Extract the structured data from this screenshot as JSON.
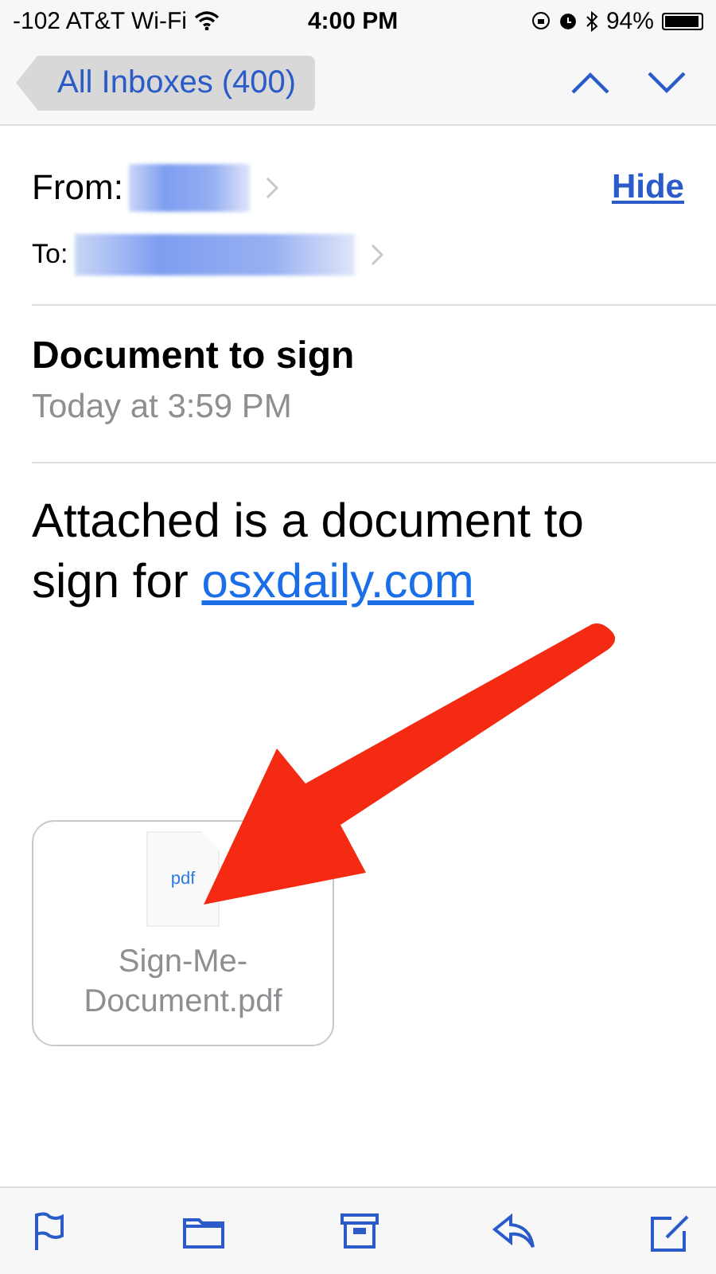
{
  "status_bar": {
    "carrier": "-102 AT&T Wi-Fi",
    "time": "4:00 PM",
    "battery": "94%"
  },
  "nav": {
    "back": "All Inboxes (400)"
  },
  "header": {
    "from_label": "From:",
    "to_label": "To:",
    "hide": "Hide"
  },
  "message": {
    "subject": "Document to sign",
    "date": "Today at 3:59 PM",
    "body": "Attached is a document to sign for ",
    "link": "osxdaily.com"
  },
  "attachment": {
    "type": "pdf",
    "name": "Sign-Me-Document.pdf"
  },
  "toolbar": [
    {
      "kind": "flag"
    },
    {
      "kind": "folder"
    },
    {
      "kind": "archive"
    },
    {
      "kind": "reply"
    },
    {
      "kind": "compose"
    }
  ]
}
